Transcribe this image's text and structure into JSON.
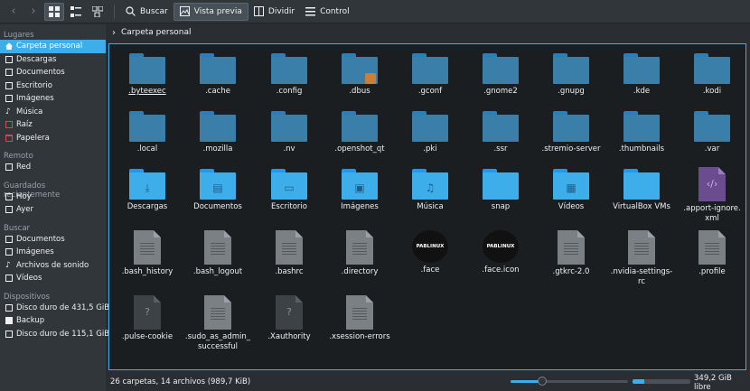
{
  "toolbar": {
    "search_label": "Buscar",
    "preview_label": "Vista previa",
    "split_label": "Dividir",
    "control_label": "Control"
  },
  "breadcrumb": {
    "current": "Carpeta personal"
  },
  "sidebar": {
    "places_title": "Lugares",
    "places": [
      "Carpeta personal",
      "Descargas",
      "Documentos",
      "Escritorio",
      "Imágenes",
      "Música",
      "Raíz",
      "Papelera"
    ],
    "remote_title": "Remoto",
    "remote": [
      "Red"
    ],
    "recent_title": "Guardados recientemente",
    "recent": [
      "Hoy",
      "Ayer"
    ],
    "search_title": "Buscar",
    "search": [
      "Documentos",
      "Imágenes",
      "Archivos de sonido",
      "Vídeos"
    ],
    "devices_title": "Dispositivos",
    "devices": [
      "Disco duro de 431,5 GiB",
      "Backup",
      "Disco duro de 115,1 GiB"
    ]
  },
  "files": {
    "row1": [
      ".byteexec",
      ".cache",
      ".config",
      ".dbus",
      ".gconf",
      ".gnome2",
      ".gnupg",
      ".kde",
      ".kodi"
    ],
    "row2": [
      ".local",
      ".mozilla",
      ".nv",
      ".openshot_qt",
      ".pki",
      ".ssr",
      ".stremio-server",
      ".thumbnails",
      ".var"
    ],
    "row3": [
      "Descargas",
      "Documentos",
      "Escritorio",
      "Imágenes",
      "Música",
      "snap",
      "Vídeos",
      "VirtualBox VMs",
      ".apport-ignore.\nxml"
    ],
    "row4": [
      ".bash_history",
      ".bash_logout",
      ".bashrc",
      ".directory",
      ".face",
      ".face.icon",
      ".gtkrc-2.0",
      ".nvidia-settings-\nrc",
      ".profile"
    ],
    "row5": [
      ".pulse-cookie",
      ".sudo_as_admin_\nsuccessful",
      ".Xauthority",
      ".xsession-errors"
    ],
    "thumb_text": "PABLINUX"
  },
  "status": {
    "summary": "26 carpetas, 14 archivos (989,7 KiB)",
    "free_space": "349,2 GiB libre",
    "zoom_level": 0.27,
    "disk_used_fraction": 0.2
  },
  "colors": {
    "accent": "#3daee9",
    "folder": "#3a7fa9",
    "background": "#1b1e20"
  }
}
